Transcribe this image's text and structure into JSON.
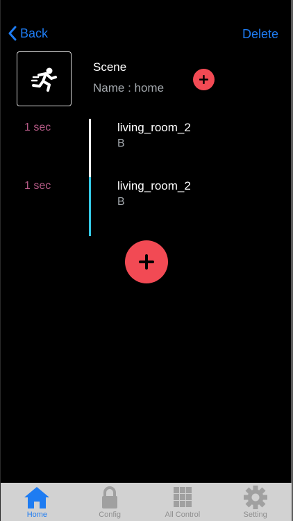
{
  "nav": {
    "back_label": "Back",
    "delete_label": "Delete"
  },
  "scene": {
    "title": "Scene",
    "name_text": "Name : home",
    "icon": "running-person-icon"
  },
  "actions": [
    {
      "time": "1 sec",
      "device": "living_room_2",
      "state": "B"
    },
    {
      "time": "1 sec",
      "device": "living_room_2",
      "state": "B"
    }
  ],
  "tabs": [
    {
      "label": "Home",
      "icon": "house-icon",
      "active": true
    },
    {
      "label": "Config",
      "icon": "lock-icon",
      "active": false
    },
    {
      "label": "All Control",
      "icon": "grid-icon",
      "active": false
    },
    {
      "label": "Setting",
      "icon": "gear-icon",
      "active": false
    }
  ],
  "colors": {
    "accent": "#1e7cf2",
    "add_button": "#f24a54",
    "time_text": "#b55a86",
    "timeline_first": "#ffffff",
    "timeline_second": "#35c9e6",
    "tabbar_bg": "#d2d2d2"
  }
}
